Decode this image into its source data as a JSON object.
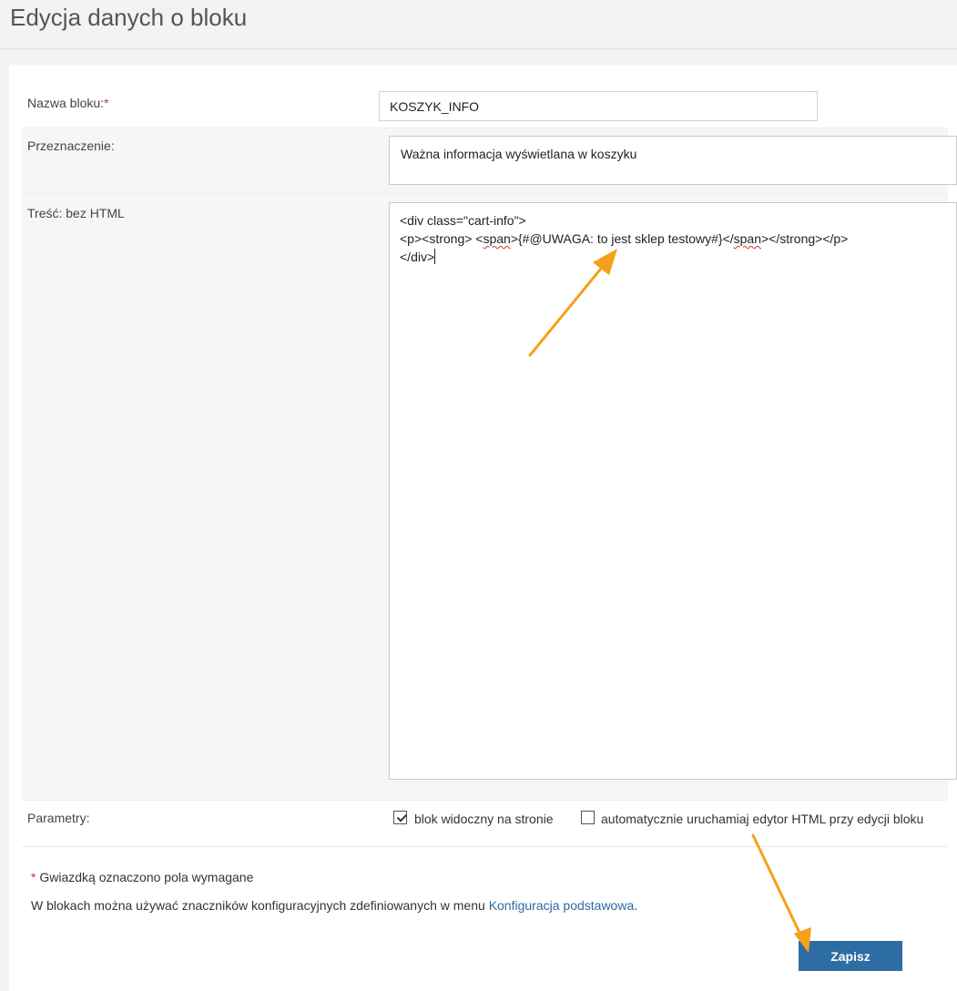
{
  "page": {
    "title": "Edycja danych o bloku"
  },
  "form": {
    "name": {
      "label": "Nazwa bloku:",
      "required_mark": "*",
      "value": "KOSZYK_INFO"
    },
    "purpose": {
      "label": "Przeznaczenie:",
      "value": "Ważna informacja wyświetlana w koszyku"
    },
    "content": {
      "label": "Treść: bez HTML",
      "line1": "<div class=\"cart-info\">",
      "line2_a": "<p><strong> <",
      "line2_span1": "span",
      "line2_b": ">{#@UWAGA: to jest sklep testowy#}</",
      "line2_span2": "span",
      "line2_c": "></strong></p>",
      "line3": "</div>"
    },
    "params": {
      "label": "Parametry:",
      "visible_label": "blok widoczny na stronie",
      "visible_checked": true,
      "auto_html_label": "automatycznie uruchamiaj edytor HTML przy edycji bloku",
      "auto_html_checked": false
    }
  },
  "notes": {
    "required_star": "*",
    "required_text": " Gwiazdką oznaczono pola wymagane",
    "tags_text": "W blokach można używać znaczników konfiguracyjnych zdefiniowanych w menu ",
    "tags_link": "Konfiguracja podstawowa",
    "tags_end": "."
  },
  "actions": {
    "save_label": "Zapisz"
  },
  "colors": {
    "accent": "#2e6da4",
    "arrow": "#f5a01a",
    "required": "#c0392b"
  }
}
